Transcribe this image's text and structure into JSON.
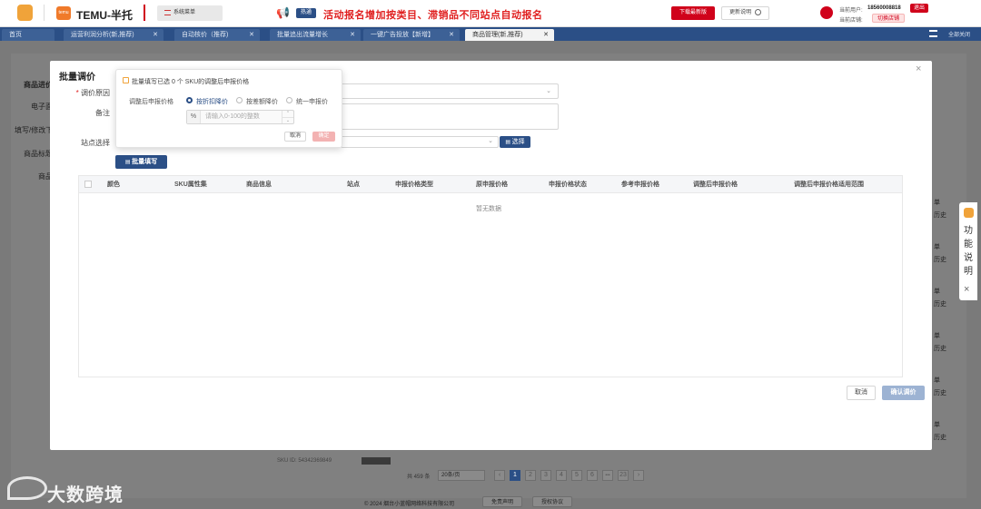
{
  "topbar": {
    "brand": "TEMU-半托",
    "brand_badge": "temu",
    "system_menu": "系统菜单",
    "promo_badge": "热通",
    "promo_text": "活动报名增加按类目、滞销品不同站点自动报名",
    "download_btn": "下载最新版",
    "update_btn": "更新说明",
    "user_label": "当前用户:",
    "user_value": "18560008818",
    "logout": "退出",
    "shop_label": "当前店铺:",
    "switch_shop": "切换店铺"
  },
  "tabs": [
    {
      "label": "首页"
    },
    {
      "label": "运营利润分析(新,推荐)"
    },
    {
      "label": "自动核价（推荐)"
    },
    {
      "label": "批量追出流量增长"
    },
    {
      "label": "一键广告投放【新增】"
    },
    {
      "label": "商品管理(新,推荐)"
    }
  ],
  "tab_right": "全部关闭",
  "sidebar_bg": [
    "商品进价",
    "电子面",
    "填写/修改下",
    "商品标题",
    "商品"
  ],
  "right_bg": [
    {
      "a": "单",
      "b": "历史"
    },
    {
      "a": "单",
      "b": "历史"
    },
    {
      "a": "单",
      "b": "历史"
    },
    {
      "a": "单",
      "b": "历史"
    },
    {
      "a": "单",
      "b": "历史"
    },
    {
      "a": "单",
      "b": "历史"
    }
  ],
  "help_panel": {
    "text": "功能说明",
    "close": "×"
  },
  "modal": {
    "title": "批量调价",
    "close": "×",
    "reason_label": "调价原因",
    "note_label": "备注",
    "site_label": "站点选择",
    "select_btn": "选择",
    "batch_fill_btn": "批量填写",
    "table_headers": [
      "颜色",
      "SKU属性集",
      "商品信息",
      "站点",
      "申报价格类型",
      "原申报价格",
      "申报价格状态",
      "参考申报价格",
      "调整后申报价格",
      "调整后申报价格适用范围"
    ],
    "empty_text": "暂无数据",
    "cancel_btn": "取消",
    "confirm_btn": "确认调价"
  },
  "popover": {
    "notice": "批量填写已选 0 个 SKU的调整后申报价格",
    "price_label": "调整后申报价格",
    "options": [
      "按折扣降价",
      "按差额降价",
      "统一申报价"
    ],
    "selected_option": 0,
    "unit": "%",
    "input_placeholder": "请输入0-100的整数",
    "cancel": "取消",
    "ok": "确定"
  },
  "pager": {
    "total": "共 459 条",
    "page_size": "20条/页",
    "pages": [
      "1",
      "2",
      "3",
      "4",
      "5",
      "6",
      "•••",
      "23"
    ],
    "current": "1",
    "prev": "‹",
    "next": "›"
  },
  "bg_row_text": "SKU ID: 54342369849",
  "footer": {
    "copyright": "© 2024 烟台小蓝帽网络科技有限公司",
    "disclaimer": "免责声明",
    "license": "授权协议"
  },
  "watermark": "大数跨境",
  "colors": {
    "primary": "#2b4f86",
    "danger": "#d0021b",
    "promo": "#e02020"
  }
}
